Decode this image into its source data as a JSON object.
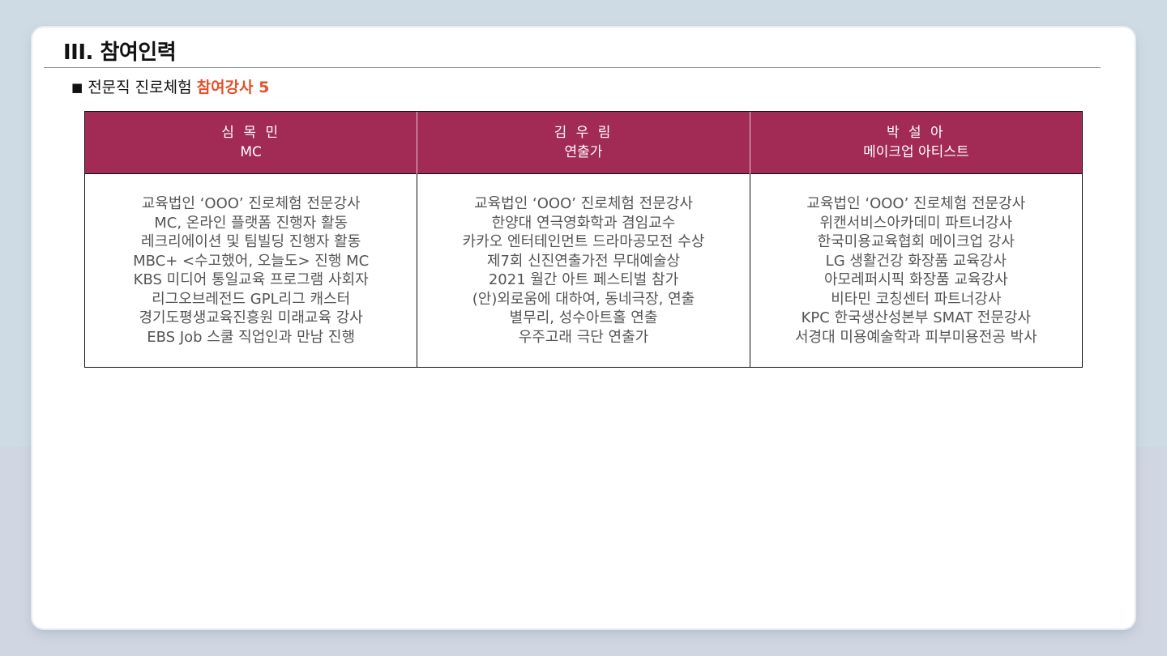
{
  "section_title": "III. 참여인력",
  "subtitle": {
    "bullet": "■",
    "text": "전문직 진로체험",
    "highlight": "참여강사 5"
  },
  "instructors": [
    {
      "name": "심 목 민",
      "role": "MC",
      "details": [
        "교육법인 ‘OOO’ 진로체험 전문강사",
        "MC, 온라인 플랫폼 진행자 활동",
        "레크리에이션 및 팀빌딩 진행자 활동",
        "MBC+ <수고했어, 오늘도> 진행 MC",
        "KBS 미디어 통일교육 프로그램 사회자",
        "리그오브레전드 GPL리그 캐스터",
        "경기도평생교육진흥원 미래교육 강사",
        "EBS Job 스쿨 직업인과 만남 진행"
      ]
    },
    {
      "name": "김 우 림",
      "role": "연출가",
      "details": [
        "교육법인 ‘OOO’ 진로체험 전문강사",
        "한양대 연극영화학과 겸임교수",
        "카카오 엔터테인먼트 드라마공모전 수상",
        "제7회 신진연출가전 무대예술상",
        "2021 월간 아트 페스티벌 참가",
        "(안)외로움에 대하여, 동네극장, 연출",
        "별무리, 성수아트홀 연출",
        "우주고래 극단 연출가"
      ]
    },
    {
      "name": "박 설 아",
      "role": "메이크업 아티스트",
      "details": [
        "교육법인 ‘OOO’ 진로체험 전문강사",
        "위캔서비스아카데미 파트너강사",
        "한국미용교육협회 메이크업 강사",
        "LG 생활건강 화장품 교육강사",
        "아모레퍼시픽 화장품 교육강사",
        "비타민 코칭센터 파트너강사",
        "KPC 한국생산성본부 SMAT 전문강사",
        "서경대 미용예술학과 피부미용전공 박사"
      ]
    }
  ],
  "colors": {
    "header_bg": "#a22b56",
    "highlight": "#e2512a"
  }
}
